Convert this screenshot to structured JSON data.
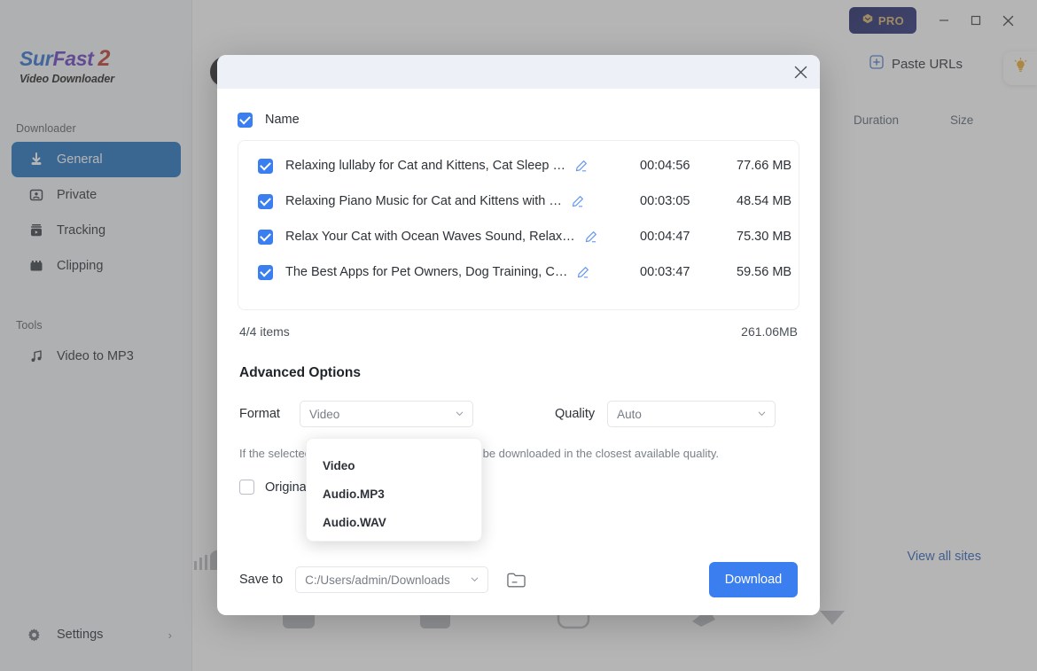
{
  "window": {
    "pro_label": "PRO",
    "minimize": "—",
    "maximize": "□",
    "close": "✕"
  },
  "sidebar": {
    "logo": {
      "part1": "Sur",
      "part2": "Fast",
      "part3": "2",
      "subtitle": "Video Downloader"
    },
    "sections": [
      {
        "title": "Downloader",
        "items": [
          {
            "label": "General",
            "icon": "download-icon",
            "active": true
          },
          {
            "label": "Private",
            "icon": "private-icon",
            "active": false
          },
          {
            "label": "Tracking",
            "icon": "tracking-icon",
            "active": false
          },
          {
            "label": "Clipping",
            "icon": "clipping-icon",
            "active": false
          }
        ]
      },
      {
        "title": "Tools",
        "items": [
          {
            "label": "Video to MP3",
            "icon": "music-note-icon",
            "active": false
          }
        ]
      }
    ],
    "settings": {
      "label": "Settings",
      "chevron": "›"
    }
  },
  "main": {
    "paste_urls": "Paste URLs",
    "view_all_sites": "View all sites"
  },
  "dialog": {
    "close_icon": "close-icon",
    "table": {
      "headers": {
        "name": "Name",
        "duration": "Duration",
        "size": "Size"
      },
      "header_checked": true,
      "rows": [
        {
          "checked": true,
          "title": "Relaxing lullaby for Cat and Kittens, Cat Sleep …",
          "duration": "00:04:56",
          "size": "77.66 MB"
        },
        {
          "checked": true,
          "title": "Relaxing Piano Music for Cat and Kittens with …",
          "duration": "00:03:05",
          "size": "48.54 MB"
        },
        {
          "checked": true,
          "title": "Relax Your Cat with Ocean Waves Sound, Relax…",
          "duration": "00:04:47",
          "size": "75.30 MB"
        },
        {
          "checked": true,
          "title": "The Best Apps for Pet Owners, Dog Training, C…",
          "duration": "00:03:47",
          "size": "59.56 MB"
        }
      ]
    },
    "summary": {
      "items": "4/4 items",
      "total_size": "261.06MB"
    },
    "advanced_title": "Advanced Options",
    "format": {
      "label": "Format",
      "value": "Video",
      "chevron": "⌄"
    },
    "quality": {
      "label": "Quality",
      "value": "Auto",
      "chevron": "⌄"
    },
    "format_dropdown": {
      "open": true,
      "options": [
        "Video",
        "Audio.MP3",
        "Audio.WAV"
      ]
    },
    "hint": "If the selected quality is unavailable, videos will be downloaded in the closest available quality.",
    "original": {
      "checked": false,
      "label": "Original"
    },
    "save_to": {
      "label": "Save to",
      "value": "C:/Users/admin/Downloads",
      "chevron": "⌄",
      "folder_icon": "folder-icon"
    },
    "download_button": "Download"
  },
  "colors": {
    "accent_blue": "#3b7ef0",
    "sidebar_active": "#1f72c0",
    "pro_gold": "#d8b36a",
    "link_blue": "#2f62b8"
  }
}
